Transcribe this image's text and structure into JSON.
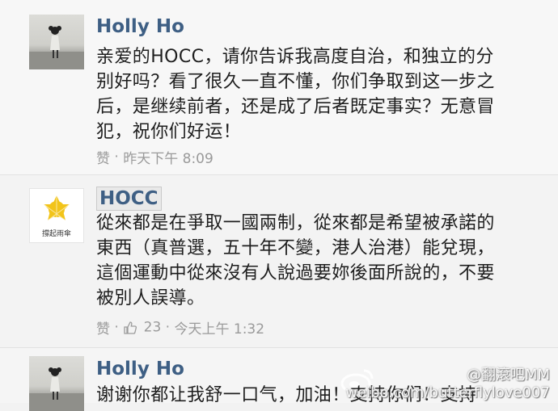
{
  "comments": [
    {
      "author": "Holly Ho",
      "lines": [
        "亲爱的HOCC，请你告诉我高度自治，和独立的分",
        "别好吗？看了很久一直不懂，你们争取到这一步之",
        "后，是继续前者，还是成了后者既定事实？无意冒",
        "犯，祝你们好运！"
      ],
      "like_label": "赞",
      "separator": "·",
      "timestamp": "昨天下午 8:09"
    },
    {
      "author": "HOCC",
      "avatar_caption": "撐起雨傘",
      "lines": [
        "從來都是在爭取一國兩制，從來都是希望被承諾的",
        "東西（真普選，五十年不變，港人治港）能兌現，",
        "這個運動中從來沒有人說過要妳後面所說的，不要",
        "被別人誤導。"
      ],
      "like_label": "赞",
      "separator": "·",
      "like_count": "23",
      "timestamp": "今天上午 1:32"
    },
    {
      "author": "Holly Ho",
      "lines": [
        "谢谢你都让我舒一口气，加油！支持你们！支持"
      ]
    }
  ],
  "watermark": {
    "handle": "@翻滾吧MM",
    "url": "weibo.com/butterflylove007"
  },
  "colors": {
    "author": "#3e5f84",
    "meta": "#9a9a9a",
    "umbrella": "#f2c41a"
  }
}
